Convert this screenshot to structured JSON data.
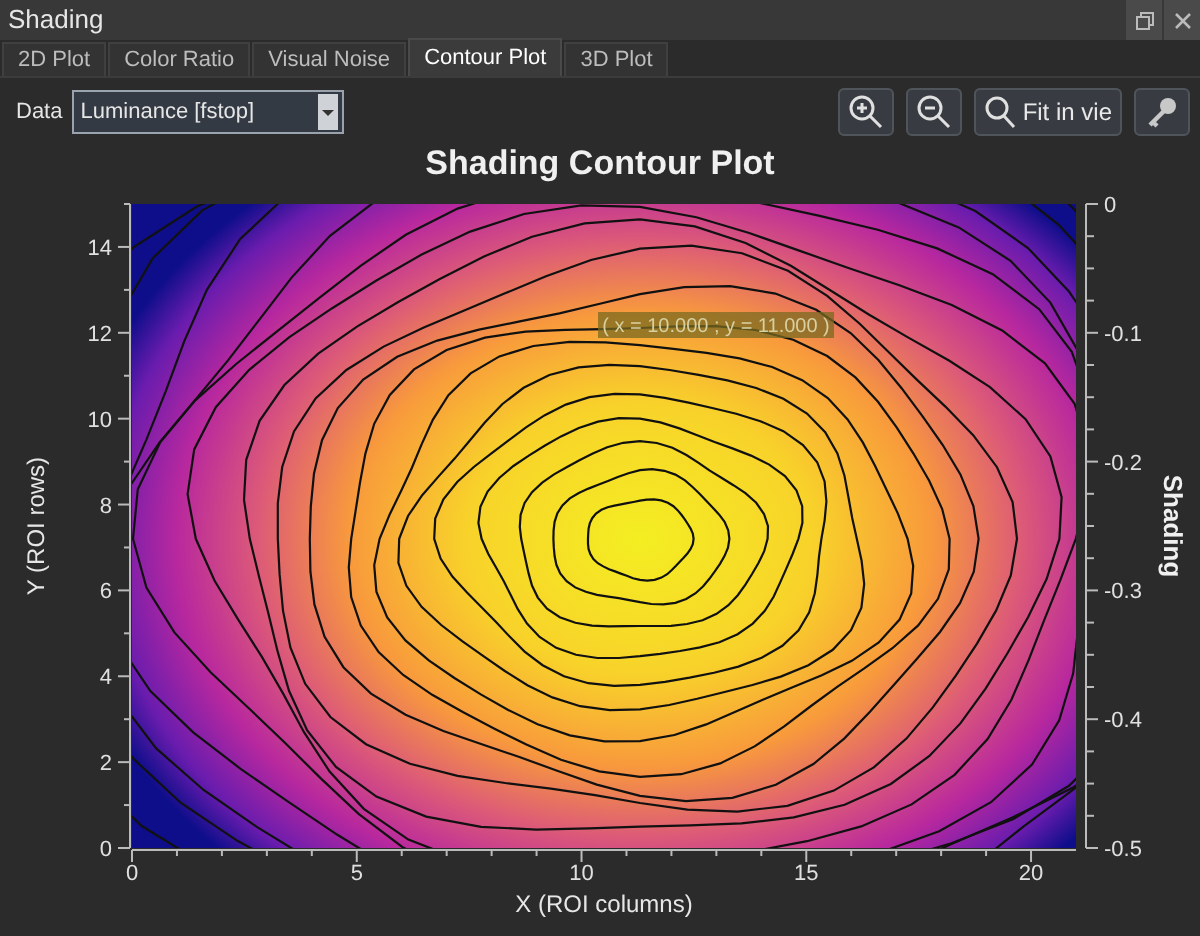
{
  "window": {
    "title": "Shading"
  },
  "tabs": [
    {
      "label": "2D Plot",
      "selected": false
    },
    {
      "label": "Color Ratio",
      "selected": false
    },
    {
      "label": "Visual Noise",
      "selected": false
    },
    {
      "label": "Contour Plot",
      "selected": true
    },
    {
      "label": "3D Plot",
      "selected": false
    }
  ],
  "data_select": {
    "label": "Data",
    "value": "Luminance [fstop]"
  },
  "toolbar": {
    "fit_button": "Fit in vie"
  },
  "plot": {
    "title": "Shading Contour Plot",
    "xlabel": "X (ROI columns)",
    "ylabel": "Y (ROI rows)",
    "xticks": [
      "0",
      "5",
      "10",
      "15",
      "20"
    ],
    "yticks": [
      "14",
      "12",
      "10",
      "8",
      "6",
      "4",
      "2",
      "0"
    ],
    "colorbar": {
      "label": "Shading",
      "ticks": [
        "0",
        "-0.1",
        "-0.2",
        "-0.3",
        "-0.4",
        "-0.5"
      ]
    },
    "tooltip": "( x = 10.000 ; y = 11.000 )"
  }
}
